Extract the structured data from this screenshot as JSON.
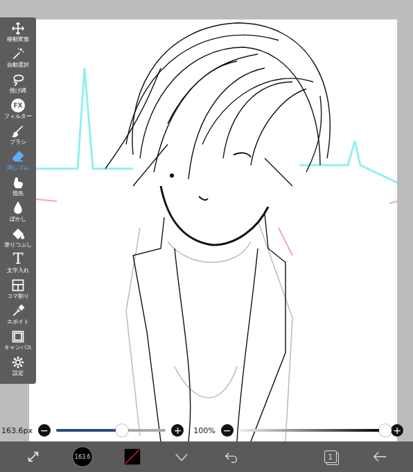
{
  "toolbar": {
    "items": [
      {
        "label": "移動変形",
        "kind": "icon",
        "selected": false
      },
      {
        "label": "自動選択",
        "kind": "icon",
        "selected": false
      },
      {
        "label": "投げ縄",
        "kind": "icon",
        "selected": false
      },
      {
        "label": "フィルター",
        "kind": "badge",
        "glyph": "FX",
        "selected": false
      },
      {
        "label": "ブラシ",
        "kind": "icon",
        "selected": false
      },
      {
        "label": "消しゴム",
        "kind": "icon",
        "selected": true
      },
      {
        "label": "指先",
        "kind": "icon",
        "selected": false
      },
      {
        "label": "ぼかし",
        "kind": "icon",
        "selected": false
      },
      {
        "label": "塗りつぶし",
        "kind": "icon",
        "selected": false
      },
      {
        "label": "文字入れ",
        "kind": "letter",
        "glyph": "T",
        "selected": false
      },
      {
        "label": "コマ割り",
        "kind": "icon",
        "selected": false
      },
      {
        "label": "スポイト",
        "kind": "icon",
        "selected": false
      },
      {
        "label": "キャンバス",
        "kind": "icon",
        "selected": false
      },
      {
        "label": "設定",
        "kind": "icon",
        "selected": false
      }
    ]
  },
  "brush_size": {
    "reading": "163.6px",
    "level": 0.6,
    "minus": "−",
    "plus": "+"
  },
  "opacity": {
    "reading": "100%",
    "level": 1.0,
    "minus": "−",
    "plus": "+"
  },
  "bottom_bar": {
    "brush_preview": "163.6",
    "layer_count": "1"
  }
}
